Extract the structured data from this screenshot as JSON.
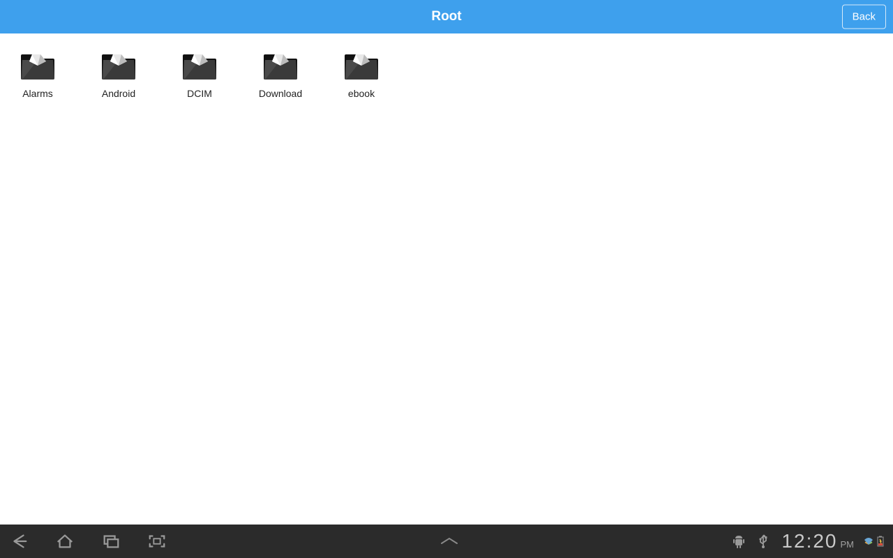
{
  "header": {
    "title": "Root",
    "back_label": "Back"
  },
  "folders": [
    {
      "name": "Alarms"
    },
    {
      "name": "Android"
    },
    {
      "name": "DCIM"
    },
    {
      "name": "Download"
    },
    {
      "name": "ebook"
    }
  ],
  "systembar": {
    "time": "12:20",
    "ampm": "PM"
  },
  "colors": {
    "accent": "#3ea0ed"
  }
}
